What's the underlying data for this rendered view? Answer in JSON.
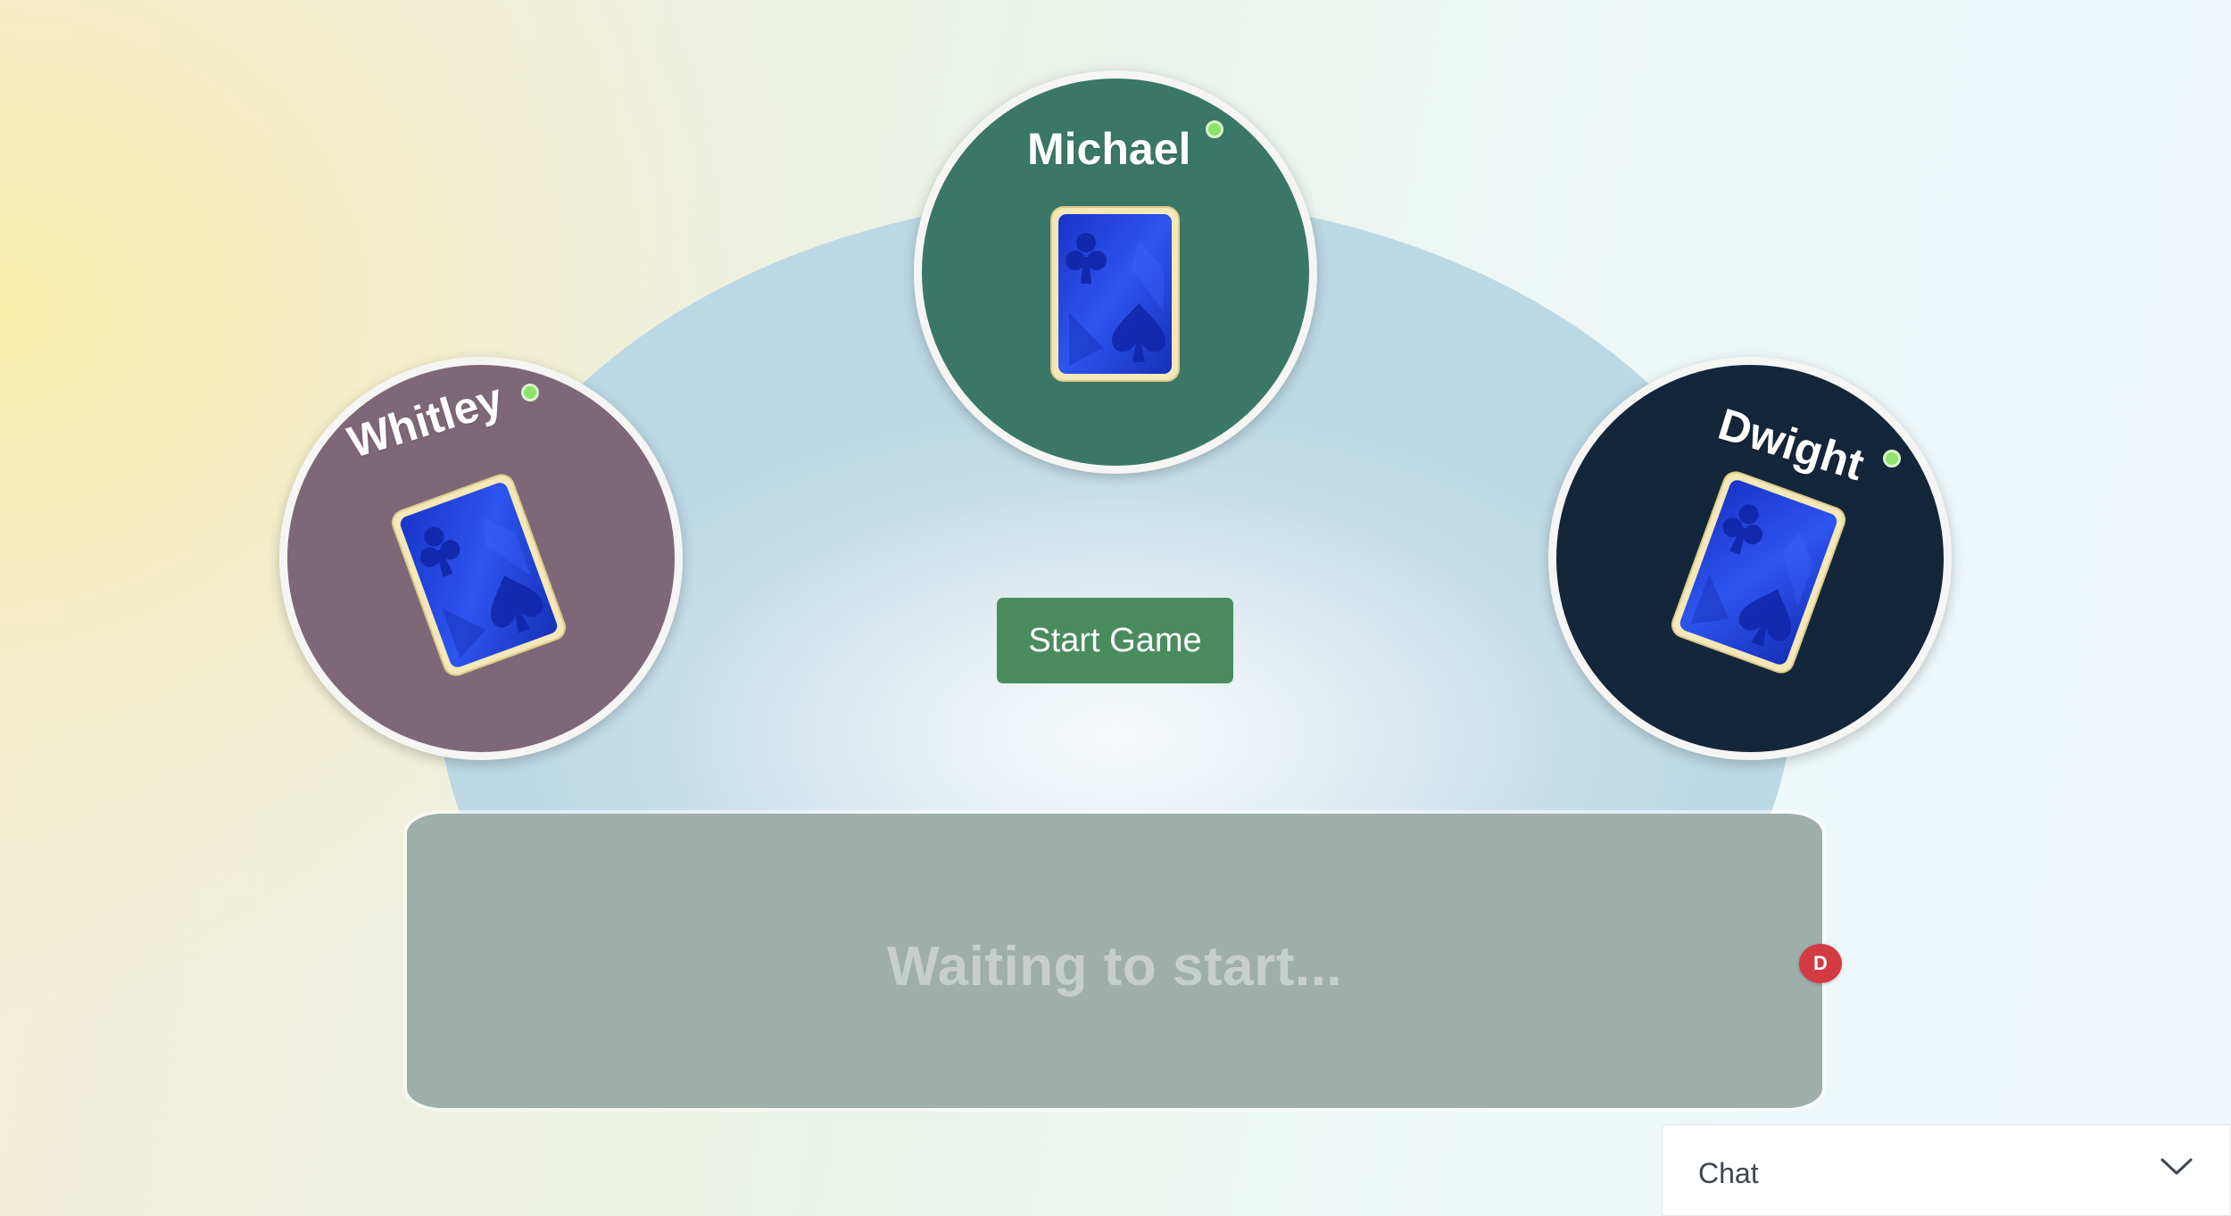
{
  "players": [
    {
      "name": "Michael",
      "online": true,
      "seat_color": "#3a7766"
    },
    {
      "name": "Whitley",
      "online": true,
      "seat_color": "#7e6776"
    },
    {
      "name": "Dwight",
      "online": true,
      "seat_color": "#14263a"
    }
  ],
  "table": {
    "status_text": "Waiting to start...",
    "dealer_badge": "D",
    "felt_color": "#bcd8e4",
    "rail_color": "#9eafaa"
  },
  "start_button": {
    "label": "Start Game",
    "color": "#4a8c5e"
  },
  "chat": {
    "label": "Chat",
    "icon": "chevron-down-icon"
  },
  "card_back": {
    "color": "#1f3fe0",
    "symbols": [
      "club",
      "spade"
    ]
  },
  "status_colors": {
    "online": "#8fe36a",
    "dealer": "#d33a41"
  }
}
